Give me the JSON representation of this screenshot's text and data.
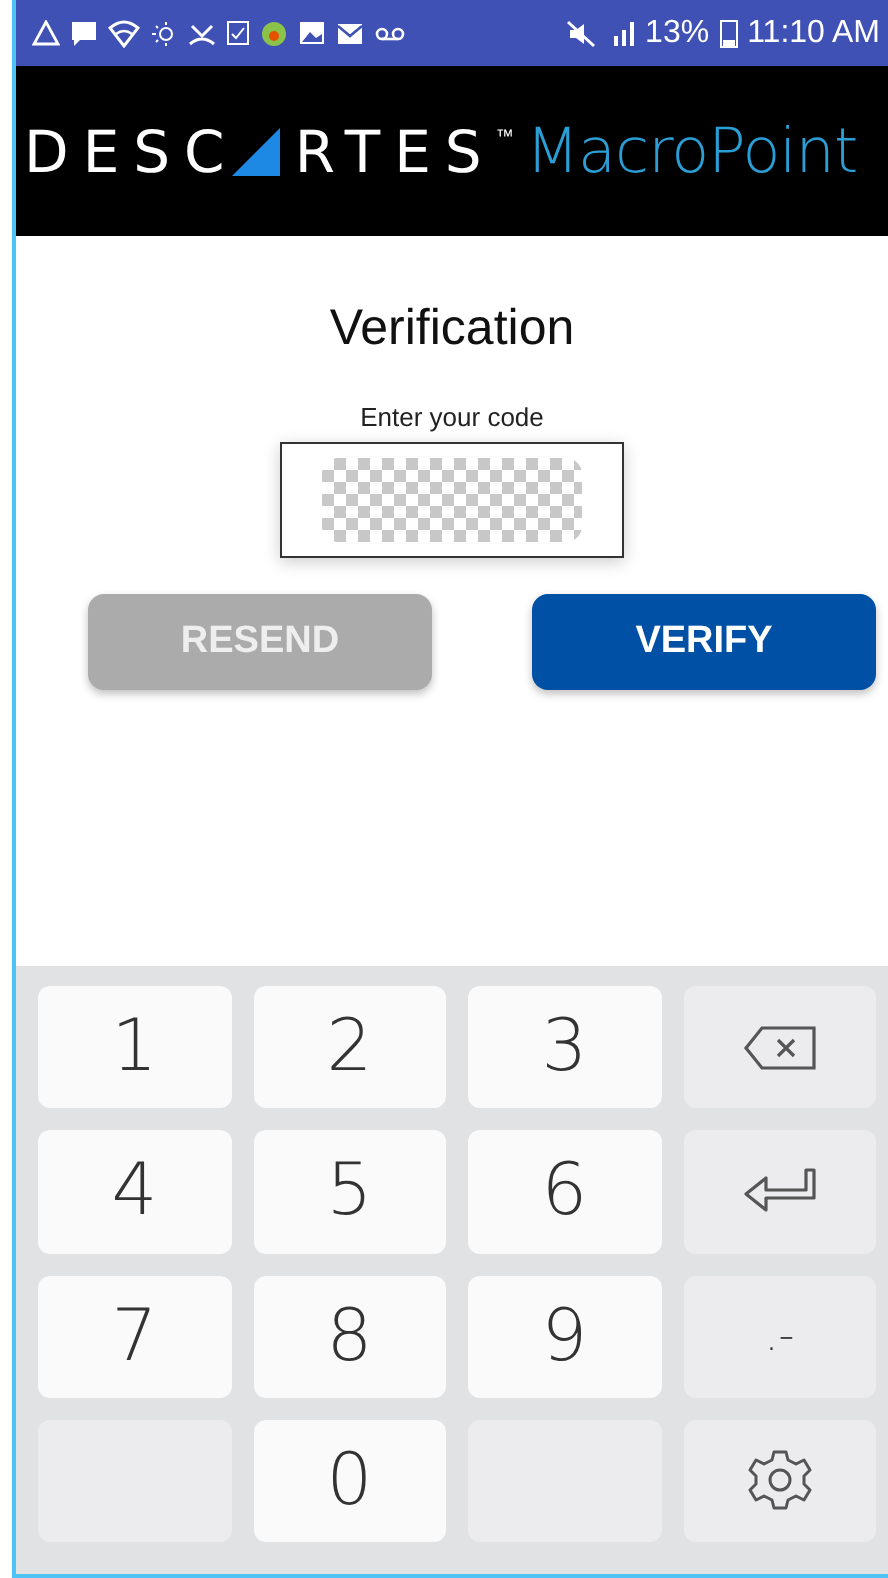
{
  "status_bar": {
    "battery": "13%",
    "time": "11:10 AM"
  },
  "logo": {
    "left": "DESC",
    "right": "RTES",
    "tm": "™",
    "product": "MacroPoint"
  },
  "title": "Verification",
  "code_field": {
    "label": "Enter your code"
  },
  "buttons": [
    {
      "label": "RESEND",
      "disabled": true
    },
    {
      "label": "VERIFY",
      "disabled": false
    }
  ],
  "keyboard": {
    "keys": [
      {
        "kind": "digit",
        "label": "1"
      },
      {
        "kind": "digit",
        "label": "2"
      },
      {
        "kind": "digit",
        "label": "3"
      },
      {
        "kind": "backspace"
      },
      {
        "kind": "digit",
        "label": "4"
      },
      {
        "kind": "digit",
        "label": "5"
      },
      {
        "kind": "digit",
        "label": "6"
      },
      {
        "kind": "enter"
      },
      {
        "kind": "digit",
        "label": "7"
      },
      {
        "kind": "digit",
        "label": "8"
      },
      {
        "kind": "digit",
        "label": "9"
      },
      {
        "kind": "symbol",
        "label": ".-"
      },
      {
        "kind": "blank"
      },
      {
        "kind": "digit",
        "label": "0"
      },
      {
        "kind": "blank"
      },
      {
        "kind": "settings"
      }
    ]
  }
}
